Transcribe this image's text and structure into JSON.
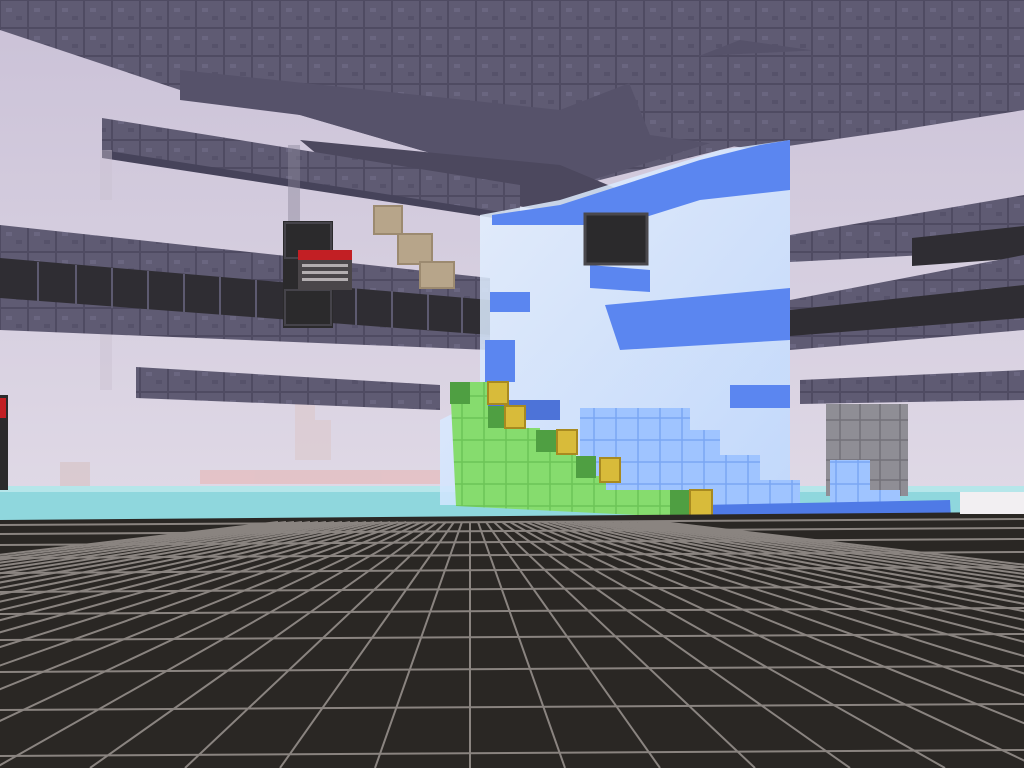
{
  "scene": {
    "kind": "voxel sandbox world, first-person view",
    "colors": {
      "sky_top": "#cdc4d8",
      "sky_bottom": "#e8e2ec",
      "stone": "#5e5a72",
      "stone_light": "#6d6983",
      "stone_dark": "#4a475b",
      "floor_tile": "#2a2724",
      "floor_grid": "#8a8480",
      "water": "#8fd6dc",
      "glass_blue": "#5b86f0",
      "glass_light": "#cfe6ff",
      "green_block": "#82d96a",
      "gold_block": "#d2b436",
      "piston_red": "#c21f24",
      "furnace_dark": "#2b2a2c",
      "wood": "#b7a58a"
    },
    "objects": [
      "stone-ceiling",
      "stone-beam",
      "dark-block-row",
      "blue-glass-wall",
      "green-staircase",
      "gold-blocks",
      "piston-block",
      "black-cube",
      "wood-block-stairs",
      "gray-tower",
      "checkered-floor",
      "water-horizon",
      "red-block"
    ]
  }
}
